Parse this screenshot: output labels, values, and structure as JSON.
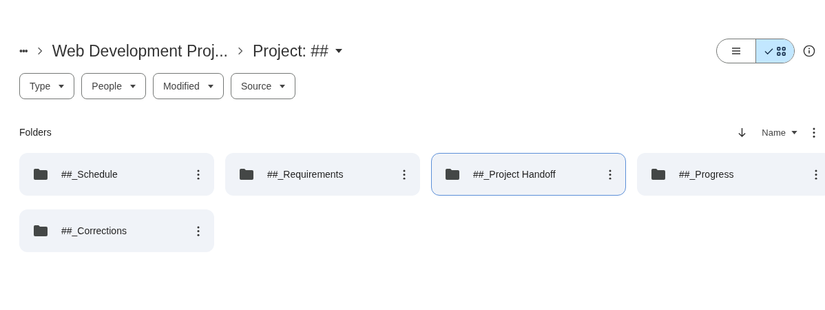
{
  "breadcrumb": {
    "overflow": "•••",
    "items": [
      "Web Development Proj...",
      "Project: ##"
    ]
  },
  "view_toggle": [
    {
      "kind": "list",
      "selected": false
    },
    {
      "kind": "grid",
      "selected": true
    }
  ],
  "filters": [
    "Type",
    "People",
    "Modified",
    "Source"
  ],
  "section": {
    "title": "Folders",
    "sort_label": "Name"
  },
  "folders": [
    {
      "name": "##_Schedule",
      "selected": false
    },
    {
      "name": "##_Requirements",
      "selected": false
    },
    {
      "name": "##_Project Handoff",
      "selected": true
    },
    {
      "name": "##_Progress",
      "selected": false
    },
    {
      "name": "##_Corrections",
      "selected": false
    }
  ]
}
